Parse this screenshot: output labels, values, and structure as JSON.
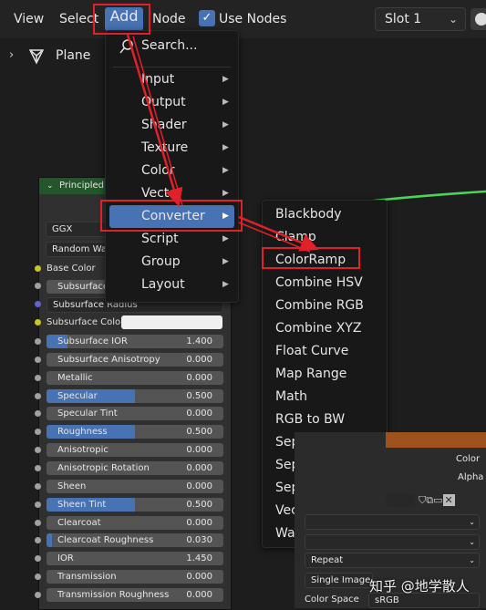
{
  "header": {
    "menu_view": "View",
    "menu_select": "Select",
    "menu_add": "Add",
    "menu_node": "Node",
    "use_nodes_label": "Use Nodes",
    "use_nodes_checked": true,
    "slot_value": "Slot 1"
  },
  "breadcrumb": {
    "object": "Plane"
  },
  "node": {
    "title": "Principled B",
    "distribution": "GGX",
    "subsurface_method": "Random Wall",
    "base_color_label": "Base Color",
    "subsurface_label": "Subsurface",
    "subsurface_radius_label": "Subsurface Radius",
    "subsurface_color_label": "Subsurface Colo",
    "fields": [
      {
        "label": "Subsurface IOR",
        "value": "1.400",
        "fill": 0.12
      },
      {
        "label": "Subsurface Anisotropy",
        "value": "0.000",
        "fill": 0
      },
      {
        "label": "Metallic",
        "value": "0.000",
        "fill": 0
      },
      {
        "label": "Specular",
        "value": "0.500",
        "fill": 0.5
      },
      {
        "label": "Specular Tint",
        "value": "0.000",
        "fill": 0
      },
      {
        "label": "Roughness",
        "value": "0.500",
        "fill": 0.5
      },
      {
        "label": "Anisotropic",
        "value": "0.000",
        "fill": 0
      },
      {
        "label": "Anisotropic Rotation",
        "value": "0.000",
        "fill": 0
      },
      {
        "label": "Sheen",
        "value": "0.000",
        "fill": 0
      },
      {
        "label": "Sheen Tint",
        "value": "0.500",
        "fill": 0.5
      },
      {
        "label": "Clearcoat",
        "value": "0.000",
        "fill": 0
      },
      {
        "label": "Clearcoat Roughness",
        "value": "0.030",
        "fill": 0.03
      },
      {
        "label": "IOR",
        "value": "1.450",
        "fill": 0
      },
      {
        "label": "Transmission",
        "value": "0.000",
        "fill": 0
      },
      {
        "label": "Transmission Roughness",
        "value": "0.000",
        "fill": 0
      }
    ]
  },
  "add_menu": {
    "search": "Search...",
    "items": [
      "Input",
      "Output",
      "Shader",
      "Texture",
      "Color",
      "Vector",
      "Converter",
      "Script",
      "Group",
      "Layout"
    ]
  },
  "converter_menu": {
    "items": [
      "Blackbody",
      "Clamp",
      "ColorRamp",
      "Combine HSV",
      "Combine RGB",
      "Combine XYZ",
      "Float Curve",
      "Map Range",
      "Math",
      "RGB to BW",
      "Separate HSV",
      "Separate RGB",
      "Separate XYZ",
      "Vector Math",
      "Wavelength"
    ]
  },
  "image_panel": {
    "color_label": "Color",
    "alpha_label": "Alpha",
    "extension": "Repeat",
    "source": "Single Image",
    "color_space_label": "Color Space",
    "color_space_value": "sRGB"
  },
  "watermark": "知乎 @地学散人",
  "colors": {
    "accent": "#4772b3",
    "node_header": "#23562b",
    "highlight_red": "#e0212a",
    "link_green": "#4bd35a",
    "image_header": "#a0521e"
  }
}
